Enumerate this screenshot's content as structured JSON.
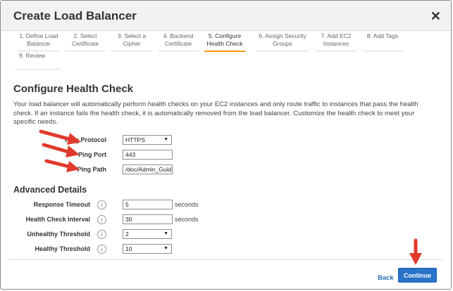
{
  "dialog": {
    "title": "Create Load Balancer"
  },
  "steps": [
    {
      "label": "1. Define Load Balancer",
      "active": false
    },
    {
      "label": "2. Select Certificate",
      "active": false
    },
    {
      "label": "3. Select a Cipher",
      "active": false
    },
    {
      "label": "4. Backend Certificate",
      "active": false
    },
    {
      "label": "5. Configure Health Check",
      "active": true
    },
    {
      "label": "6. Assign Security Groups",
      "active": false
    },
    {
      "label": "7. Add EC2 Instances",
      "active": false
    },
    {
      "label": "8. Add Tags",
      "active": false
    },
    {
      "label": "9. Review",
      "active": false
    }
  ],
  "health_check": {
    "title": "Configure Health Check",
    "description": "Your load balancer will automatically perform health checks on your EC2 instances and only route traffic to instances that pass the health check. If an instance fails the health check, it is automatically removed from the load balancer. Customize the health check to meet your specific needs.",
    "ping_protocol_label": "Ping Protocol",
    "ping_protocol_value": "HTTPS",
    "ping_port_label": "Ping Port",
    "ping_port_value": "443",
    "ping_path_label": "Ping Path",
    "ping_path_value": "/doc/Admin_Guid"
  },
  "advanced": {
    "title": "Advanced Details",
    "response_timeout_label": "Response Timeout",
    "response_timeout_value": "5",
    "response_timeout_unit": "seconds",
    "interval_label": "Health Check Interval",
    "interval_value": "30",
    "interval_unit": "seconds",
    "unhealthy_label": "Unhealthy Threshold",
    "unhealthy_value": "2",
    "healthy_label": "Healthy Threshold",
    "healthy_value": "10",
    "info_glyph": "i"
  },
  "footer": {
    "back_label": "Back",
    "continue_label": "Continue"
  },
  "icons": {
    "close": "close-icon",
    "info": "info-icon",
    "dropdown": "chevron-down-icon",
    "annotation": "red-arrow-annotation"
  },
  "colors": {
    "accent": "#ff9900",
    "annotation_red": "#e03a2c",
    "primary_button": "#2a73c9",
    "link": "#2a6ebb"
  }
}
